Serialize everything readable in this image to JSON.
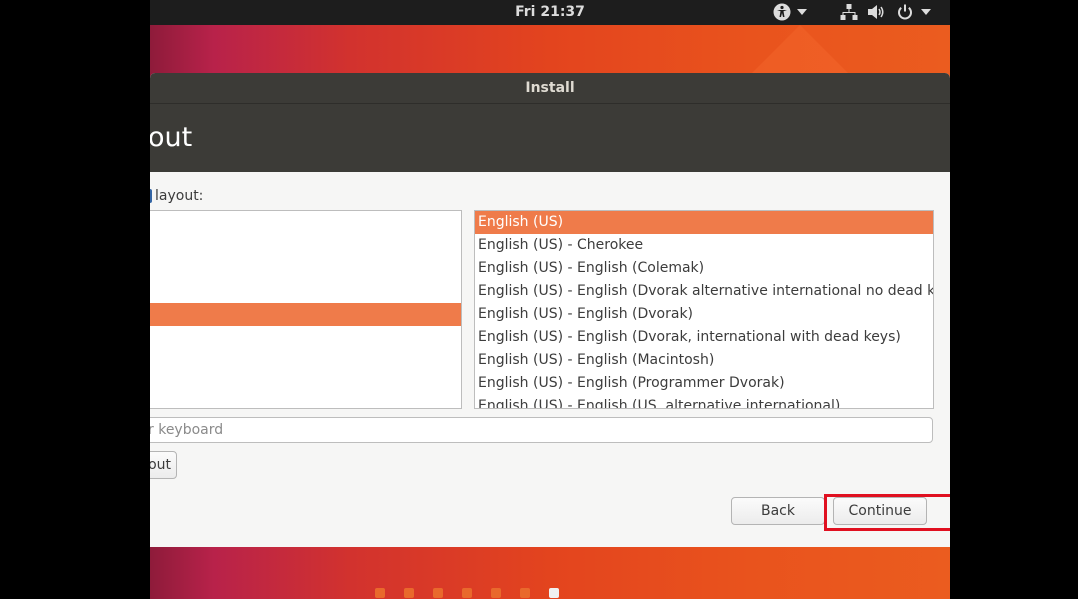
{
  "top_panel": {
    "clock": "Fri 21:37",
    "icons": [
      "accessibility-icon",
      "network-icon",
      "volume-icon",
      "power-icon"
    ]
  },
  "window": {
    "title": "Install",
    "page_title": "yout"
  },
  "content": {
    "layout_label": "layout:",
    "language_list_selected_index": 4,
    "variants": [
      "English (US)",
      "English (US) - Cherokee",
      "English (US) - English (Colemak)",
      "English (US) - English (Dvorak alternative international no dead keys)",
      "English (US) - English (Dvorak)",
      "English (US) - English (Dvorak, international with dead keys)",
      "English (US) - English (Macintosh)",
      "English (US) - English (Programmer Dvorak)",
      "English (US) - English (US, alternative international)"
    ],
    "variant_selected_index": 0,
    "test_placeholder": "r keyboard",
    "detect_label": "out",
    "back_label": "Back",
    "continue_label": "Continue"
  },
  "progress": {
    "total_steps": 7,
    "current_step": 7
  },
  "colors": {
    "accent_orange": "#ef7b4a",
    "titlebar": "#3c3b37",
    "highlight_red": "#e01020"
  }
}
